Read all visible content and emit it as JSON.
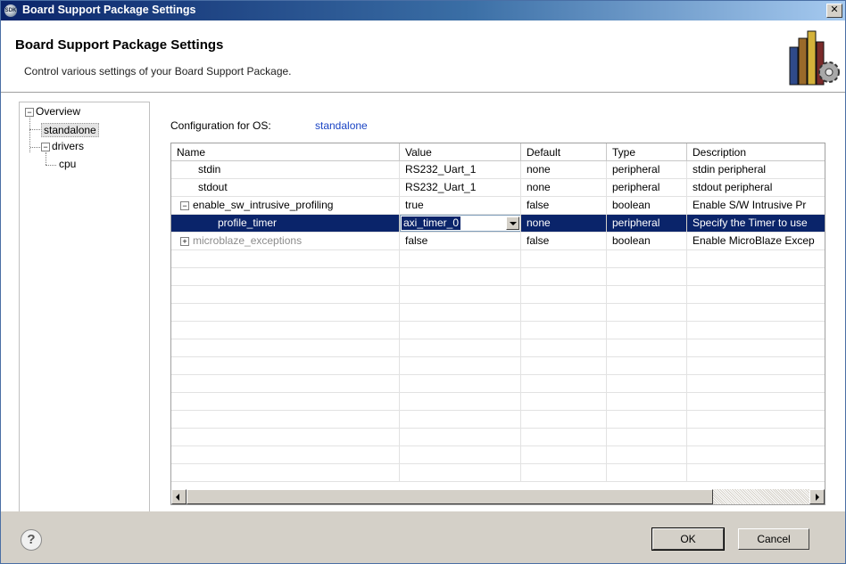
{
  "window": {
    "title": "Board Support Package Settings",
    "icon_text": "SDK",
    "close_glyph": "✕"
  },
  "header": {
    "title": "Board Support Package Settings",
    "subtitle": "Control various settings of your Board Support Package."
  },
  "tree": {
    "items": [
      {
        "label": "Overview",
        "toggle": "−"
      },
      {
        "label": "standalone"
      },
      {
        "label": "drivers",
        "toggle": "−"
      },
      {
        "label": "cpu"
      }
    ]
  },
  "config": {
    "label": "Configuration for OS:",
    "os": "standalone"
  },
  "table": {
    "columns": [
      "Name",
      "Value",
      "Default",
      "Type",
      "Description"
    ],
    "rows": [
      {
        "name": "stdin",
        "value": "RS232_Uart_1",
        "default": "none",
        "type": "peripheral",
        "description": "stdin peripheral"
      },
      {
        "name": "stdout",
        "value": "RS232_Uart_1",
        "default": "none",
        "type": "peripheral",
        "description": "stdout peripheral"
      },
      {
        "name": "enable_sw_intrusive_profiling",
        "toggle": "−",
        "value": "true",
        "default": "false",
        "type": "boolean",
        "description": "Enable S/W Intrusive Pr"
      },
      {
        "name": "profile_timer",
        "value": "axi_timer_0",
        "default": "none",
        "type": "peripheral",
        "description": "Specify the Timer to use"
      },
      {
        "name": "microblaze_exceptions",
        "toggle": "+",
        "value": "false",
        "default": "false",
        "type": "boolean",
        "description": "Enable MicroBlaze Excep"
      }
    ]
  },
  "footer": {
    "help_glyph": "?",
    "ok_label": "OK",
    "cancel_label": "Cancel"
  },
  "colors": {
    "selection": "#0a246a",
    "link": "#1a44c4",
    "dialog_bg": "#d4d0c8"
  }
}
